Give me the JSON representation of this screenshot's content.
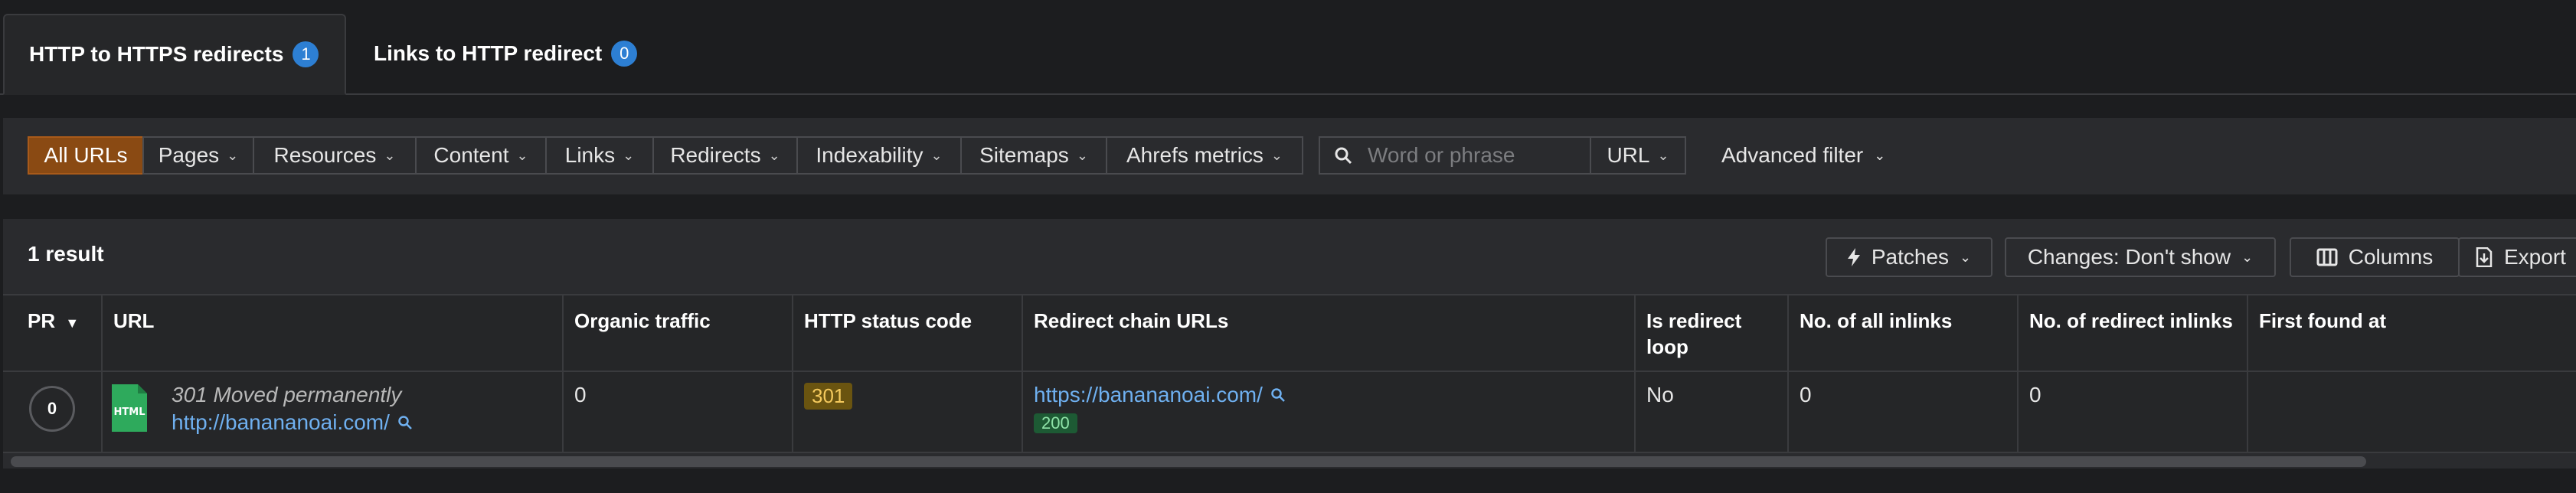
{
  "tabs": [
    {
      "label": "HTTP to HTTPS redirects",
      "count": "1"
    },
    {
      "label": "Links to HTTP redirect",
      "count": "0"
    }
  ],
  "filters": {
    "segments": [
      "All URLs",
      "Pages",
      "Resources",
      "Content",
      "Links",
      "Redirects",
      "Indexability",
      "Sitemaps",
      "Ahrefs metrics"
    ],
    "search_placeholder": "Word or phrase",
    "scope": "URL",
    "advanced": "Advanced filter"
  },
  "results": {
    "count": "1 result",
    "patches": "Patches",
    "changes": "Changes: Don't show",
    "columns": "Columns",
    "export": "Export"
  },
  "table": {
    "headers": {
      "pr": "PR",
      "url": "URL",
      "organic": "Organic traffic",
      "status": "HTTP status code",
      "chain": "Redirect chain URLs",
      "loop": "Is redirect loop",
      "inlinks": "No. of all inlinks",
      "redirect_inlinks": "No. of redirect inlinks",
      "first_found": "First found at"
    },
    "row": {
      "pr": "0",
      "url_status": "301 Moved permanently",
      "url": "http://banananoai.com/",
      "organic": "0",
      "status_code": "301",
      "chain_url": "https://banananoai.com/",
      "chain_code": "200",
      "loop": "No",
      "inlinks": "0",
      "redirect_inlinks": "0"
    }
  },
  "colors": {
    "accent_all_urls": "#8a4a13",
    "badge": "#2d7fd3",
    "link": "#6fb0f0",
    "status_301": "#6a5410",
    "status_200": "#1d5a34"
  }
}
